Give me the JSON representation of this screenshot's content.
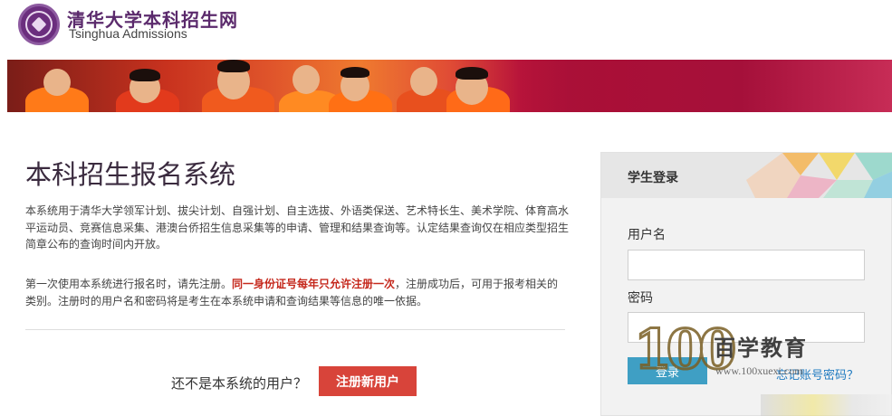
{
  "header": {
    "title_cn": "清华大学本科招生网",
    "title_en": "Tsinghua Admissions"
  },
  "main": {
    "title": "本科招生报名系统",
    "intro": "本系统用于清华大学领军计划、拔尖计划、自强计划、自主选拔、外语类保送、艺术特长生、美术学院、体育高水平运动员、竞赛信息采集、港澳台侨招生信息采集等的申请、管理和结果查询等。认定结果查询仅在相应类型招生简章公布的查询时间内开放。",
    "register_note_before": "第一次使用本系统进行报名时，请先注册。",
    "register_note_highlight": "同一身份证号每年只允许注册一次",
    "register_note_after": "，注册成功后，可用于报考相关的类别。注册时的用户名和密码将是考生在本系统申请和查询结果等信息的唯一依据。",
    "not_user_text": "还不是本系统的用户？",
    "register_button": "注册新用户"
  },
  "login": {
    "title": "学生登录",
    "username_label": "用户名",
    "username_value": "",
    "password_label": "密码",
    "password_value": "",
    "login_button": "登录",
    "forgot_link": "忘记账号密码？"
  },
  "watermark": {
    "number": "100",
    "name": "百学教育",
    "url": "www.100xuexi.com"
  },
  "colors": {
    "brand_purple": "#5b2a6c",
    "accent_red": "#d8443a",
    "highlight_red": "#c5281c",
    "login_blue": "#3f9fc4",
    "link_blue": "#1f7ac0"
  }
}
